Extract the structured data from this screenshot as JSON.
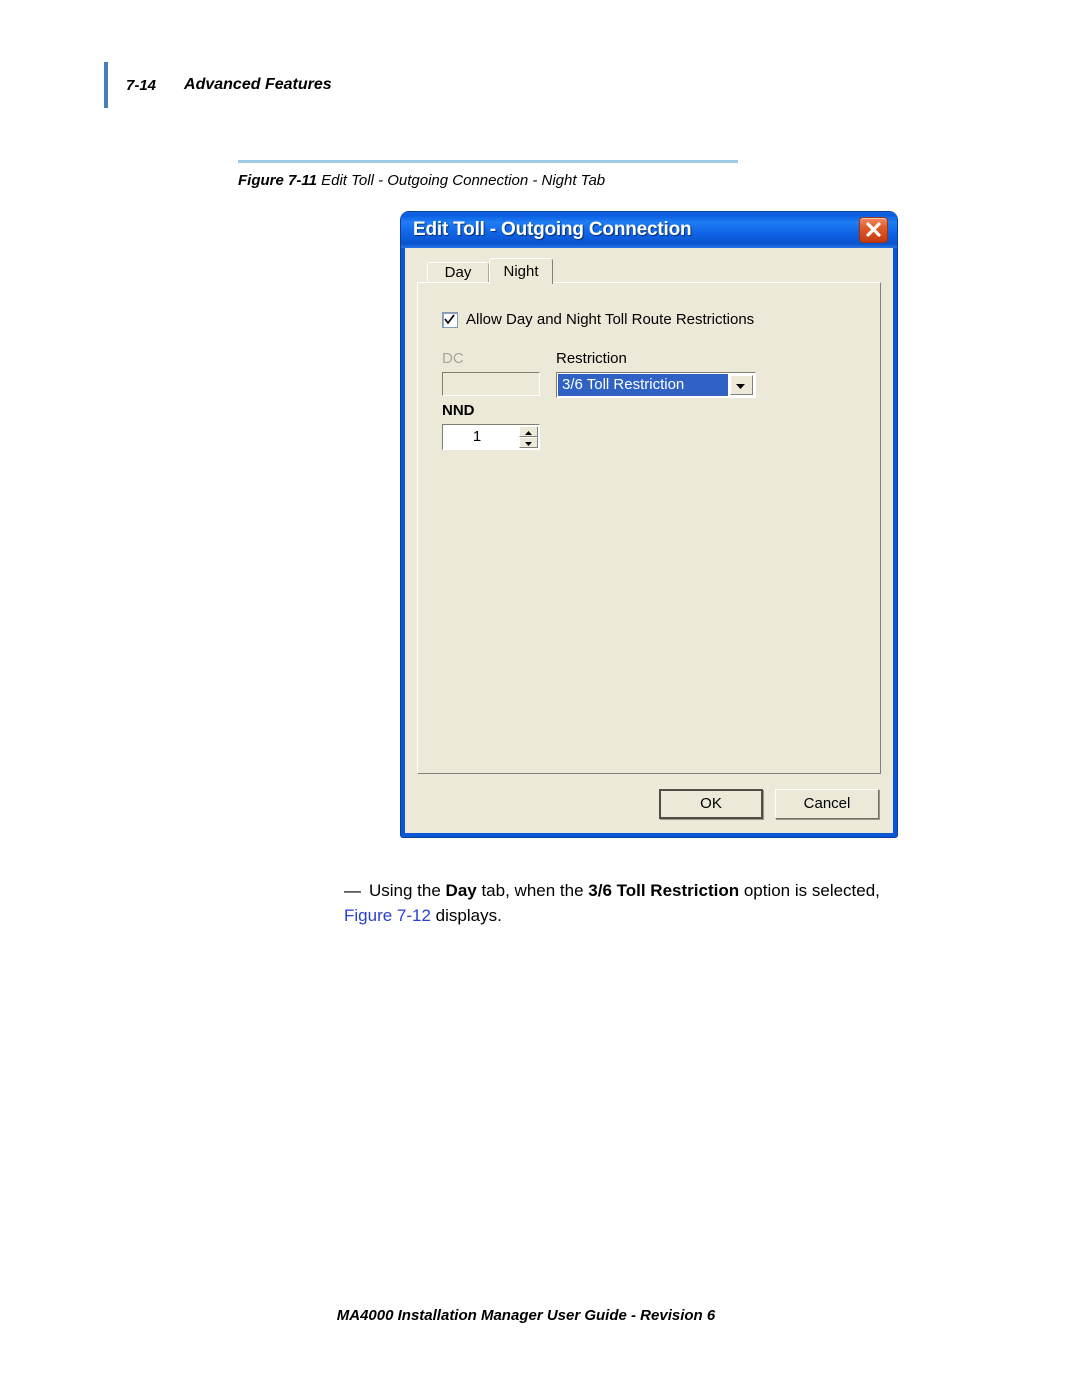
{
  "header": {
    "page_number": "7-14",
    "section_title": "Advanced Features"
  },
  "figure": {
    "caption_label": "Figure 7-11",
    "caption_text": "Edit Toll - Outgoing Connection - Night Tab"
  },
  "dialog": {
    "title": "Edit Toll - Outgoing Connection",
    "close_icon": "close-x-icon",
    "tabs": [
      {
        "label": "Day",
        "active": false
      },
      {
        "label": "Night",
        "active": true
      }
    ],
    "checkbox": {
      "label": "Allow Day and Night Toll Route Restrictions",
      "checked": true,
      "check_icon": "checkmark-icon"
    },
    "fields": {
      "dc_label": "DC",
      "dc_value": "",
      "dc_enabled": false,
      "nnd_label": "NND",
      "nnd_value": "1",
      "spinner_up_icon": "triangle-up-icon",
      "spinner_down_icon": "triangle-down-icon",
      "restriction_label": "Restriction",
      "restriction_value": "3/6 Toll Restriction",
      "restriction_dropdown_icon": "chevron-down-icon"
    },
    "buttons": {
      "ok": "OK",
      "cancel": "Cancel"
    }
  },
  "body": {
    "dash": "—",
    "part1": "Using the ",
    "bold1": "Day",
    "part2": " tab, when the ",
    "bold2": "3/6 Toll Restriction",
    "part3": " option is selected, ",
    "xref": "Figure 7-12",
    "part4": " displays."
  },
  "footer": {
    "text": "MA4000 Installation Manager User Guide - Revision  6"
  },
  "colors": {
    "header_rule": "#4a7ebb",
    "caption_rule": "#9dcbe4",
    "dialog_frame": "#0a57d4",
    "dialog_face": "#ece9d8",
    "selection_blue": "#2f62c4",
    "xref_blue": "#2b3fd0"
  }
}
